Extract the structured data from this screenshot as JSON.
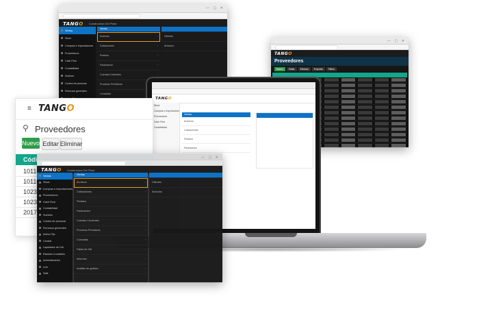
{
  "brand": {
    "name_main": "TANG",
    "name_accent": "O"
  },
  "company": "Constructora Del Plata",
  "topright_window": {
    "menu_header": "Ventas",
    "sidebar": [
      "Ventas",
      "Stock",
      "Compras e Importaciones",
      "Proveedores",
      "Cash Flow",
      "Contabilidad",
      "Sueldos",
      "Control de personal",
      "Recursos generales",
      "Activo Fijo",
      "Central",
      "Liquidador de IVA",
      "Estados Contables",
      "Administración",
      "Live",
      "Salir"
    ],
    "submenu": [
      "Archivos",
      "Cotizaciones",
      "Pedidos",
      "Facturación",
      "Cuentas Corrientes",
      "Procesos Periódicos",
      "Consultas",
      "Fallas de IVA",
      "Informes",
      "Análisis de gestión"
    ],
    "detail": [
      "Clientes",
      "Artículos"
    ]
  },
  "table_window": {
    "title": "Proveedores",
    "buttons": [
      "Nuevo",
      "Editar",
      "Eliminar",
      "Exportar",
      "Filtros"
    ]
  },
  "laptop": {
    "menu_header": "Ventas",
    "sidebar": [
      "Stock",
      "Compras e Importaciones",
      "Proveedores",
      "Cash Flow",
      "Contabilidad"
    ],
    "submenu": [
      "Archivos",
      "Cotizaciones",
      "Pedidos",
      "Facturación"
    ]
  },
  "proveedores_panel": {
    "title": "Proveedores",
    "btn_new": "Nuevo",
    "btn_edit": "Editar",
    "btn_delete": "Eliminar",
    "col_header": "Códig",
    "codes": [
      "101101",
      "101107",
      "102321",
      "102322",
      "201764"
    ]
  },
  "front_window": {
    "menu_header": "Ventas",
    "sidebar": [
      "Ventas",
      "Stock",
      "Compras e Importaciones",
      "Proveedores",
      "Cash Flow",
      "Contabilidad",
      "Sueldos",
      "Control de personal",
      "Recursos generales",
      "Activo Fijo",
      "Central",
      "Liquidador de IVA",
      "Estados Contables",
      "Administración",
      "Live",
      "Salir"
    ],
    "submenu": [
      "Archivos",
      "Cotizaciones",
      "Pedidos",
      "Facturación",
      "Cuentas Corrientes",
      "Procesos Periódicos",
      "Consultas",
      "Fallas de IVA",
      "Informes",
      "Análisis de gestión"
    ],
    "detail": [
      "Clientes",
      "Artículos"
    ]
  },
  "colors": {
    "accent_blue": "#0c73c7",
    "accent_orange": "#e99b23",
    "teal": "#13a68c",
    "green": "#2e9c4a",
    "dark_bg": "#121212"
  }
}
